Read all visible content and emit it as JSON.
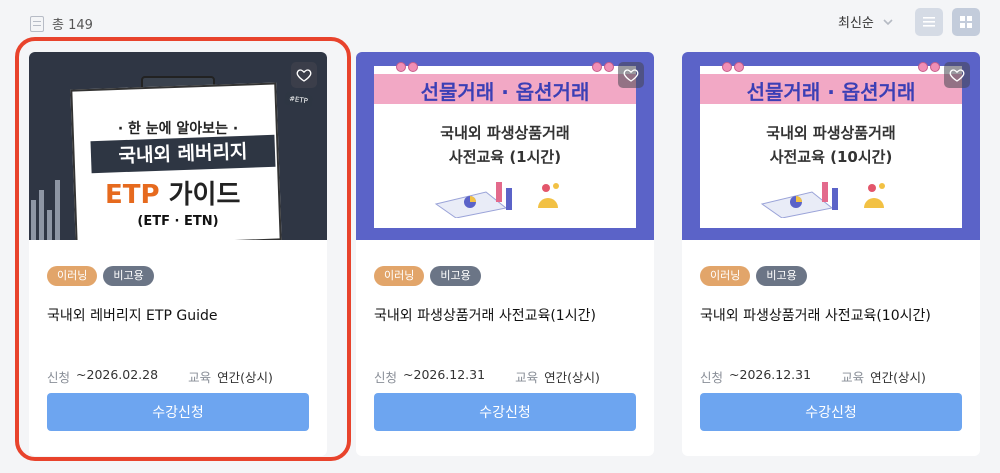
{
  "header": {
    "total_label": "총 149",
    "sort_label": "최신순"
  },
  "cards": [
    {
      "tags": [
        "이러닝",
        "비고용"
      ],
      "title": "국내외 레버리지 ETP Guide",
      "apply_label": "신청",
      "apply_value": "~2026.02.28",
      "edu_label": "교육",
      "edu_value": "연간(상시)",
      "button_label": "수강신청",
      "thumb": {
        "sub": "· 한 눈에 알아보는 ·",
        "line1": "국내외 레버리지",
        "line2_a": "ETP",
        "line2_b": " 가이드",
        "paren": "(ETF · ETN)",
        "badge": "#ETP"
      }
    },
    {
      "tags": [
        "이러닝",
        "비고용"
      ],
      "title": "국내외 파생상품거래 사전교육(1시간)",
      "apply_label": "신청",
      "apply_value": "~2026.12.31",
      "edu_label": "교육",
      "edu_value": "연간(상시)",
      "button_label": "수강신청",
      "thumb": {
        "head": "선물거래 · 옵션거래",
        "sub1": "국내외 파생상품거래",
        "sub2": "사전교육 (1시간)"
      }
    },
    {
      "tags": [
        "이러닝",
        "비고용"
      ],
      "title": "국내외 파생상품거래 사전교육(10시간)",
      "apply_label": "신청",
      "apply_value": "~2026.12.31",
      "edu_label": "교육",
      "edu_value": "연간(상시)",
      "button_label": "수강신청",
      "thumb": {
        "head": "선물거래 · 옵션거래",
        "sub1": "국내외 파생상품거래",
        "sub2": "사전교육 (10시간)"
      }
    }
  ],
  "colors": {
    "accent_button": "#6da5f0",
    "highlight": "#e8432c",
    "tag_elearn": "#e2a56a",
    "tag_free": "#6b7586"
  },
  "icons": [
    "document-icon",
    "chevron-down-icon",
    "list-view-icon",
    "grid-view-icon",
    "heart-icon"
  ]
}
